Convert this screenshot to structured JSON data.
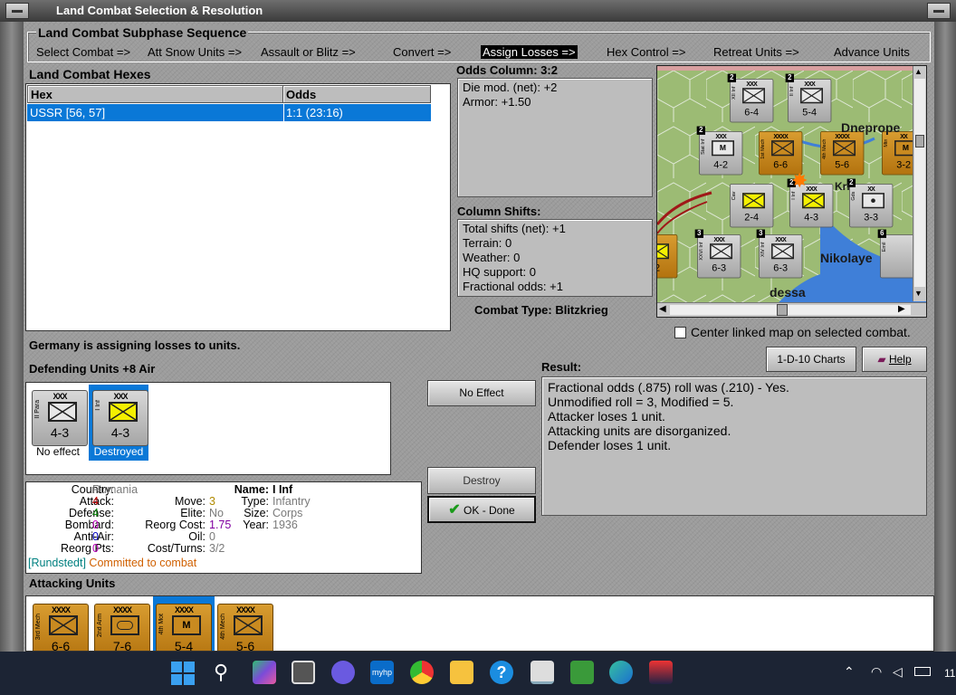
{
  "window": {
    "title": "Land Combat Selection & Resolution"
  },
  "subphase": {
    "title": "Land Combat Subphase Sequence",
    "steps": [
      "Select Combat =>",
      "Att Snow Units =>",
      "Assault or Blitz =>",
      "Convert =>",
      "Assign Losses =>",
      "Hex Control =>",
      "Retreat Units =>",
      "Advance Units"
    ],
    "active_index": 4
  },
  "hexes": {
    "title": "Land Combat Hexes",
    "col_hex": "Hex",
    "col_odds": "Odds",
    "rows": [
      {
        "hex": "USSR [56, 57]",
        "odds": "1:1 (23:16)"
      }
    ]
  },
  "odds": {
    "title": "Odds Column: 3:2",
    "lines": [
      "Die mod. (net): +2",
      "Armor: +1.50"
    ]
  },
  "shifts": {
    "title": "Column Shifts:",
    "lines": [
      "Total shifts (net): +1",
      "Terrain: 0",
      "Weather: 0",
      "HQ support: 0",
      "Fractional odds: +1"
    ]
  },
  "combat_type": "Combat Type:  Blitzkrieg",
  "map": {
    "labels": {
      "dnep": "Dneprope",
      "kri": "Kri",
      "nikolay": "Nikolaye",
      "odessa": "dessa"
    },
    "counters": [
      {
        "size": "XXX",
        "str": "6-4",
        "t": "g",
        "sym": "x",
        "stack": "2",
        "vn": "XII Inf"
      },
      {
        "size": "XXX",
        "str": "5-4",
        "t": "g",
        "sym": "x",
        "stack": "2",
        "vn": "II Inf"
      },
      {
        "size": "XXX",
        "str": "4-2",
        "t": "g",
        "sym": "m",
        "stack": "2",
        "vn": "Stat Inf"
      },
      {
        "size": "XXXX",
        "str": "6-6",
        "t": "o",
        "sym": "x",
        "stack": "",
        "vn": "1st Mech"
      },
      {
        "size": "XXXX",
        "str": "5-6",
        "t": "o",
        "sym": "x",
        "stack": "",
        "vn": "4th Mech"
      },
      {
        "size": "XX",
        "str": "3-2",
        "t": "o",
        "sym": "m",
        "stack": "",
        "vn": "Mtn"
      },
      {
        "size": "",
        "str": "2-4",
        "t": "g",
        "sym": "y",
        "stack": "",
        "vn": "Cav"
      },
      {
        "size": "XXX",
        "str": "4-3",
        "t": "g",
        "sym": "y",
        "stack": "2",
        "vn": "I Inf"
      },
      {
        "size": "XX",
        "str": "3-3",
        "t": "g",
        "sym": "d",
        "stack": "2",
        "vn": "Gds"
      },
      {
        "size": "XXX",
        "str": "6-3",
        "t": "g",
        "sym": "x",
        "stack": "3",
        "vn": "XXVI Inf"
      },
      {
        "size": "XXX",
        "str": "6-3",
        "t": "g",
        "sym": "x",
        "stack": "3",
        "vn": "XIV Inf"
      },
      {
        "size": "",
        "str": "-2",
        "t": "o",
        "sym": "y",
        "stack": "",
        "vn": ""
      },
      {
        "size": "",
        "str": "",
        "t": "g",
        "sym": "",
        "stack": "6",
        "vn": "Emil"
      }
    ]
  },
  "center_linked": {
    "label": "Center linked map on selected combat.",
    "checked": false
  },
  "status": "Germany is assigning losses to units.",
  "defending": {
    "title": "Defending Units +8 Air",
    "units": [
      {
        "size": "XXX",
        "vn": "II Para",
        "str": "4-3",
        "sym": "x",
        "caption": "No effect",
        "selected": false
      },
      {
        "size": "XXX",
        "vn": "I Inf",
        "str": "4-3",
        "sym": "y",
        "caption": "Destroyed",
        "selected": true
      }
    ]
  },
  "buttons": {
    "charts": "1-D-10 Charts",
    "help": "Help",
    "no_effect": "No Effect",
    "destroy": "Destroy",
    "ok": "OK - Done"
  },
  "result": {
    "title": "Result:",
    "lines": [
      "Fractional odds (.875) roll was (.210)  - Yes.",
      "Unmodified roll = 3, Modified = 5.",
      "Attacker loses 1 unit.",
      "Attacking units are disorganized.",
      "Defender loses 1 unit."
    ]
  },
  "info": {
    "country_k": "Country:",
    "country_v": "Rumania",
    "name_k": "Name:",
    "name_v": "I Inf",
    "attack_k": "Attack:",
    "attack_v": "4",
    "move_k": "Move:",
    "move_v": "3",
    "type_k": "Type:",
    "type_v": "Infantry",
    "defense_k": "Defense:",
    "defense_v": "4",
    "elite_k": "Elite:",
    "elite_v": "No",
    "size_k": "Size:",
    "size_v": "Corps",
    "bombard_k": "Bombard:",
    "bombard_v": "0",
    "reorg_k": "Reorg Cost:",
    "reorg_v": "1.75",
    "year_k": "Year:",
    "year_v": "1936",
    "aa_k": "Anti-Air:",
    "aa_v": "0",
    "oil_k": "Oil:",
    "oil_v": "0",
    "rpts_k": "Reorg Pts:",
    "rpts_v": "0",
    "cost_k": "Cost/Turns:",
    "cost_v": "3/2",
    "hq": "[Rundstedt]",
    "committed": "Committed to combat"
  },
  "attacking": {
    "title": "Attacking Units",
    "units": [
      {
        "size": "XXXX",
        "vn": "3rd Mech",
        "str": "6-6",
        "sym": "x",
        "selected": false
      },
      {
        "size": "XXXX",
        "vn": "2nd Arm",
        "str": "7-6",
        "sym": "a",
        "selected": false
      },
      {
        "size": "XXXX",
        "vn": "4th Mot",
        "str": "5-4",
        "sym": "m",
        "selected": true
      },
      {
        "size": "XXXX",
        "vn": "4th Mech",
        "str": "5-6",
        "sym": "x",
        "selected": false
      }
    ]
  },
  "taskbar": {
    "time": "11"
  },
  "colors": {
    "attack": "#c00000",
    "defense": "#008000",
    "bombard": "#c000c0",
    "antiair": "#0000c0",
    "reorg": "#8000a0",
    "grey_val": "#7a7a7a",
    "hq": "#008080",
    "committed": "#d06000",
    "selection": "#0a78d7"
  }
}
